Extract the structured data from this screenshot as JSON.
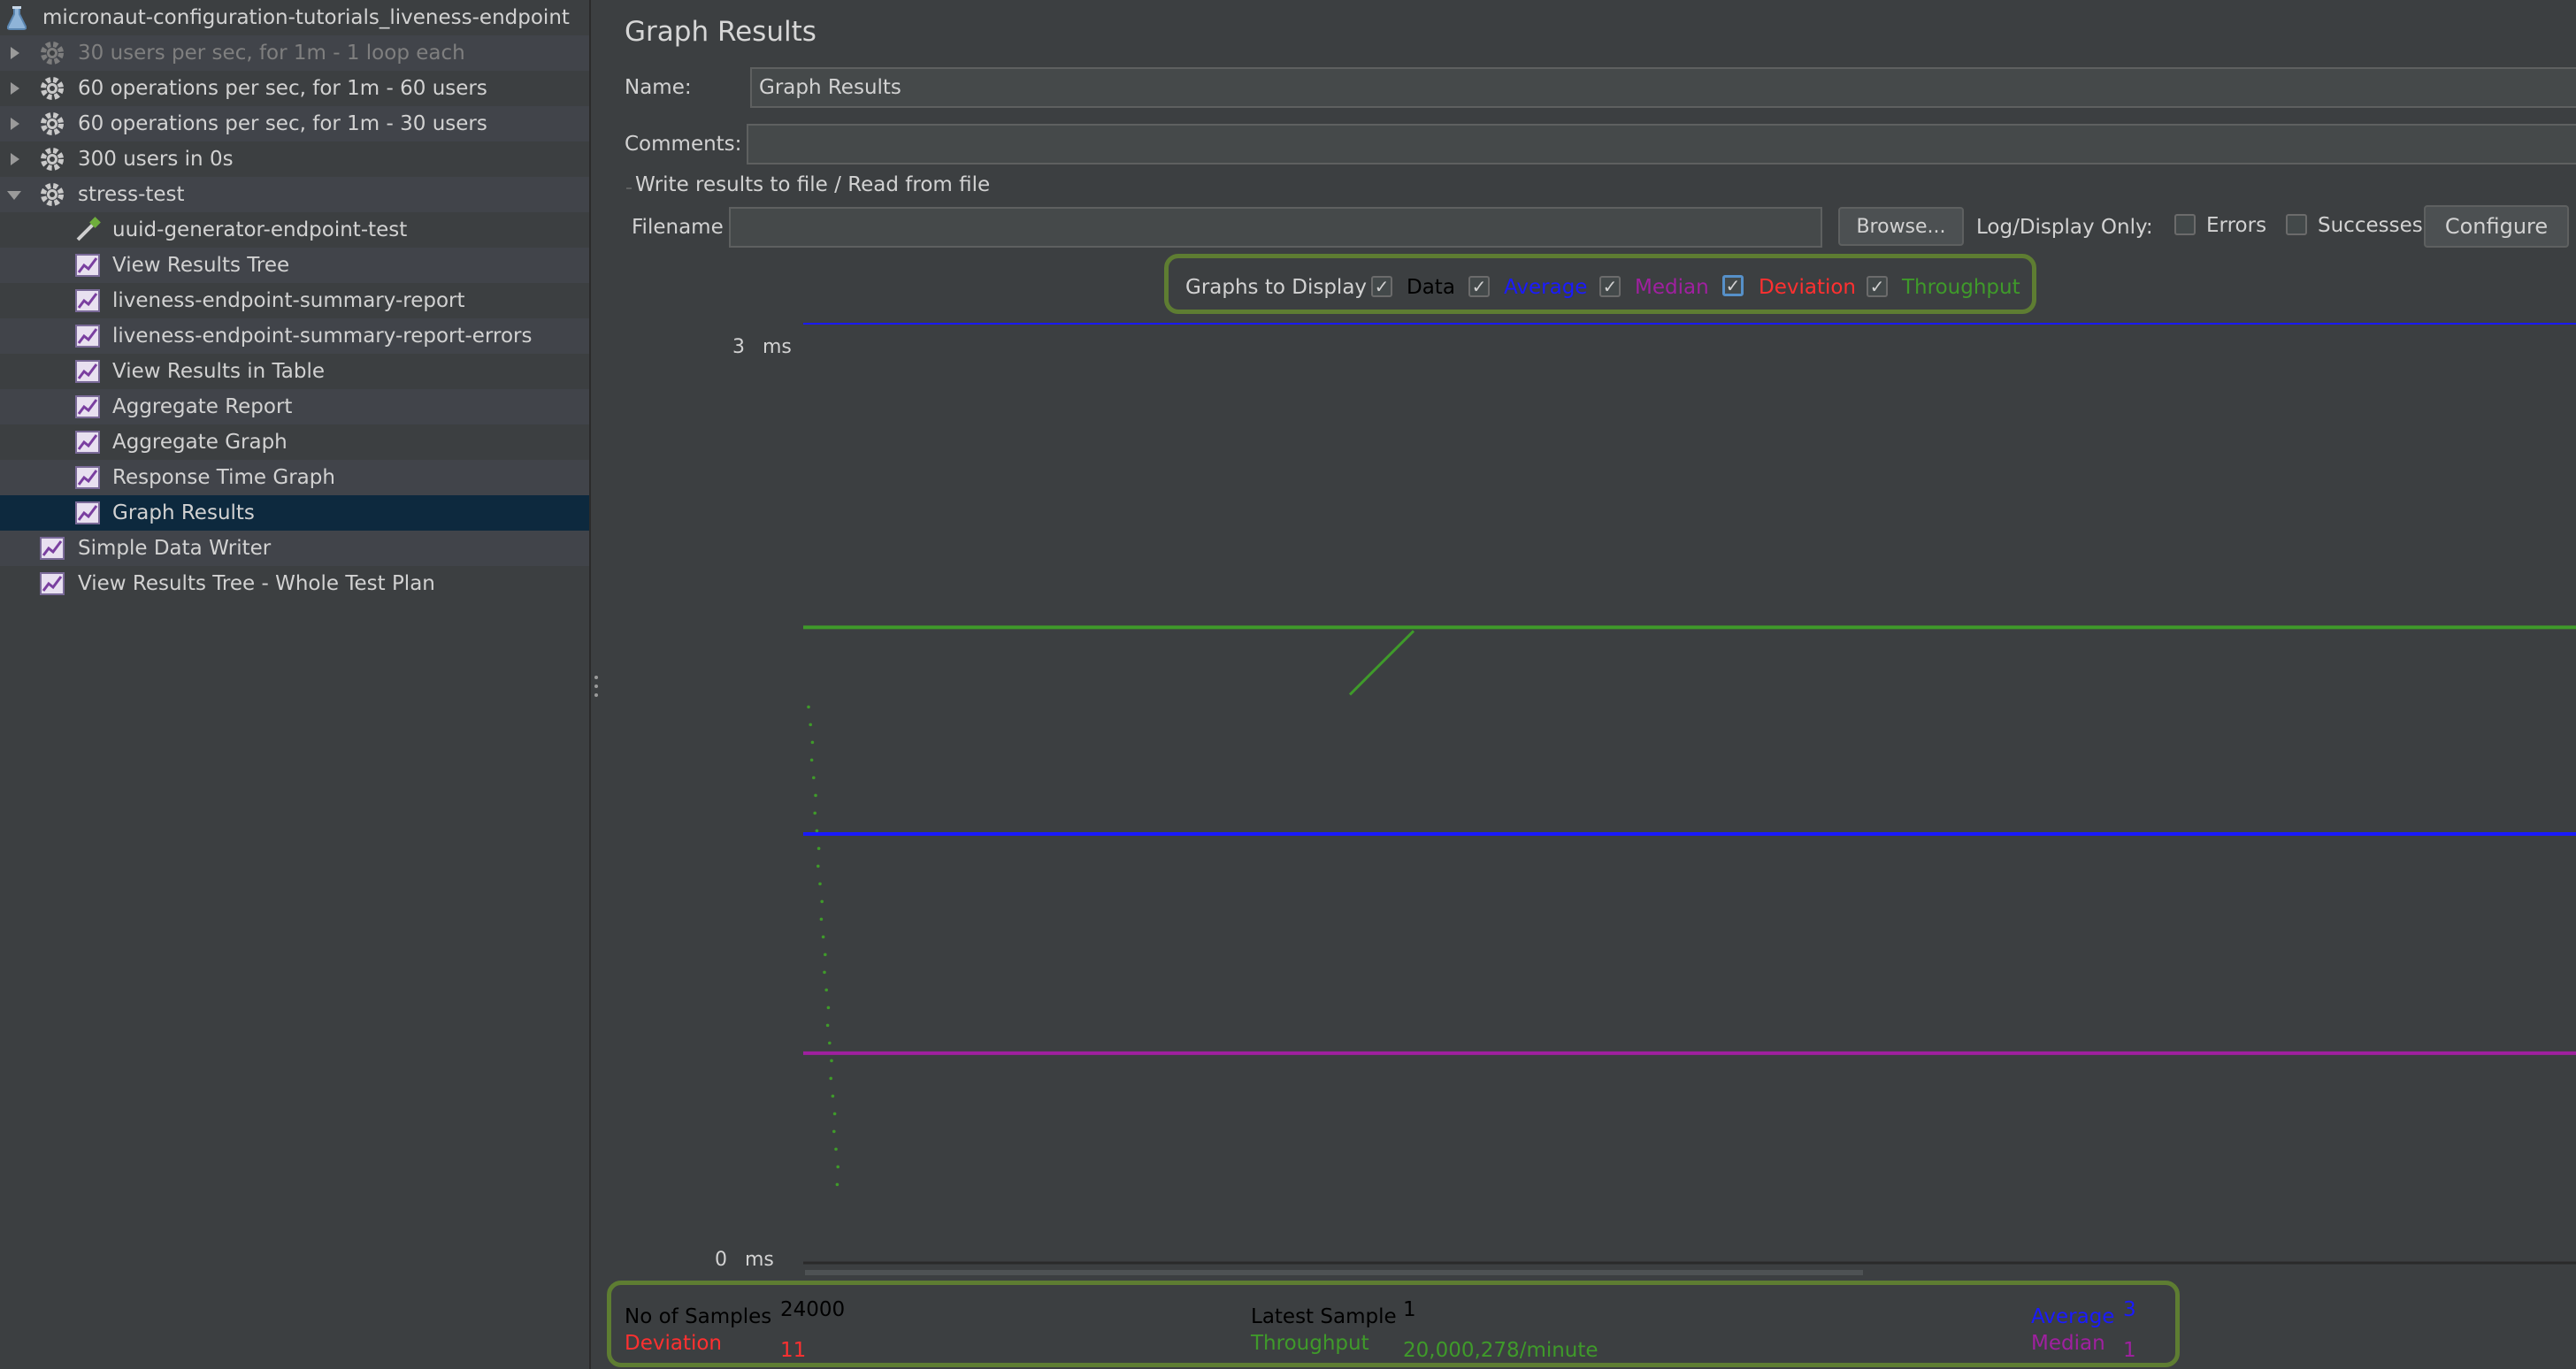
{
  "tree": {
    "root": {
      "label": "micronaut-configuration-tutorials_liveness-endpoint",
      "icon": "flask-icon"
    },
    "items": [
      {
        "label": "30 users per sec, for 1m - 1 loop each",
        "icon": "gear-icon",
        "disabled": true,
        "expanded": false
      },
      {
        "label": "60 operations per sec, for 1m - 60 users",
        "icon": "gear-icon",
        "expanded": false
      },
      {
        "label": "60 operations per sec, for 1m - 30 users",
        "icon": "gear-icon",
        "expanded": false
      },
      {
        "label": "300 users in 0s",
        "icon": "gear-icon",
        "expanded": false
      },
      {
        "label": "stress-test",
        "icon": "gear-icon",
        "expanded": true
      },
      {
        "label": "uuid-generator-endpoint-test",
        "icon": "pipette-icon"
      },
      {
        "label": "View Results Tree",
        "icon": "listener-icon"
      },
      {
        "label": "liveness-endpoint-summary-report",
        "icon": "listener-icon"
      },
      {
        "label": "liveness-endpoint-summary-report-errors",
        "icon": "listener-icon"
      },
      {
        "label": "View Results in Table",
        "icon": "listener-icon"
      },
      {
        "label": "Aggregate Report",
        "icon": "listener-icon"
      },
      {
        "label": "Aggregate Graph",
        "icon": "listener-icon"
      },
      {
        "label": "Response Time Graph",
        "icon": "listener-icon"
      },
      {
        "label": "Graph Results",
        "icon": "listener-icon",
        "selected": true
      },
      {
        "label": "Simple Data Writer",
        "icon": "listener-icon"
      },
      {
        "label": "View Results Tree - Whole Test Plan",
        "icon": "listener-icon"
      }
    ]
  },
  "panel": {
    "title": "Graph Results",
    "name_label": "Name:",
    "name_value": "Graph Results",
    "comments_label": "Comments:",
    "comments_value": "",
    "file_section_label": "Write results to file / Read from file",
    "filename_label": "Filename",
    "filename_value": "",
    "browse_label": "Browse...",
    "log_display_label": "Log/Display Only:",
    "errors_label": "Errors",
    "successes_label": "Successes",
    "configure_label": "Configure"
  },
  "graphs_to_display": {
    "label": "Graphs to Display",
    "options": [
      {
        "label": "Data",
        "checked": true,
        "color": "#000000"
      },
      {
        "label": "Average",
        "checked": true,
        "color": "#1a1aff"
      },
      {
        "label": "Median",
        "checked": true,
        "color": "#a020a0"
      },
      {
        "label": "Deviation",
        "checked": true,
        "color": "#ff3030"
      },
      {
        "label": "Throughput",
        "checked": true,
        "color": "#3f9a2a"
      }
    ]
  },
  "chart_data": {
    "type": "line",
    "ylim": [
      0,
      3
    ],
    "y_top_label": "3",
    "y_bottom_label": "0",
    "y_unit": "ms",
    "series": [
      {
        "label_ref": "Average",
        "color": "#1a1aff",
        "level": 3
      },
      {
        "label_ref": "Throughput",
        "color": "#3f9a2a",
        "level": 2.03
      },
      {
        "label_ref": "Data",
        "color": "#000000",
        "level": 1.37
      },
      {
        "label_ref": "Average (running)",
        "color": "#1a1aff",
        "level": 1.37
      },
      {
        "label_ref": "Median",
        "color": "#a020a0",
        "level": 0.67
      }
    ]
  },
  "stats": {
    "samples_label": "No of Samples",
    "samples_value": "24000",
    "deviation_label": "Deviation",
    "deviation_value": "11",
    "latest_label": "Latest Sample",
    "latest_value": "1",
    "throughput_label": "Throughput",
    "throughput_value": "20,000,278/minute",
    "average_label": "Average",
    "average_value": "3",
    "median_label": "Median",
    "median_value": "1"
  },
  "colors": {
    "average": "#1a1aff",
    "median": "#a020a0",
    "deviation": "#ff3030",
    "throughput": "#3f9a2a",
    "highlight": "#5e7d32"
  }
}
